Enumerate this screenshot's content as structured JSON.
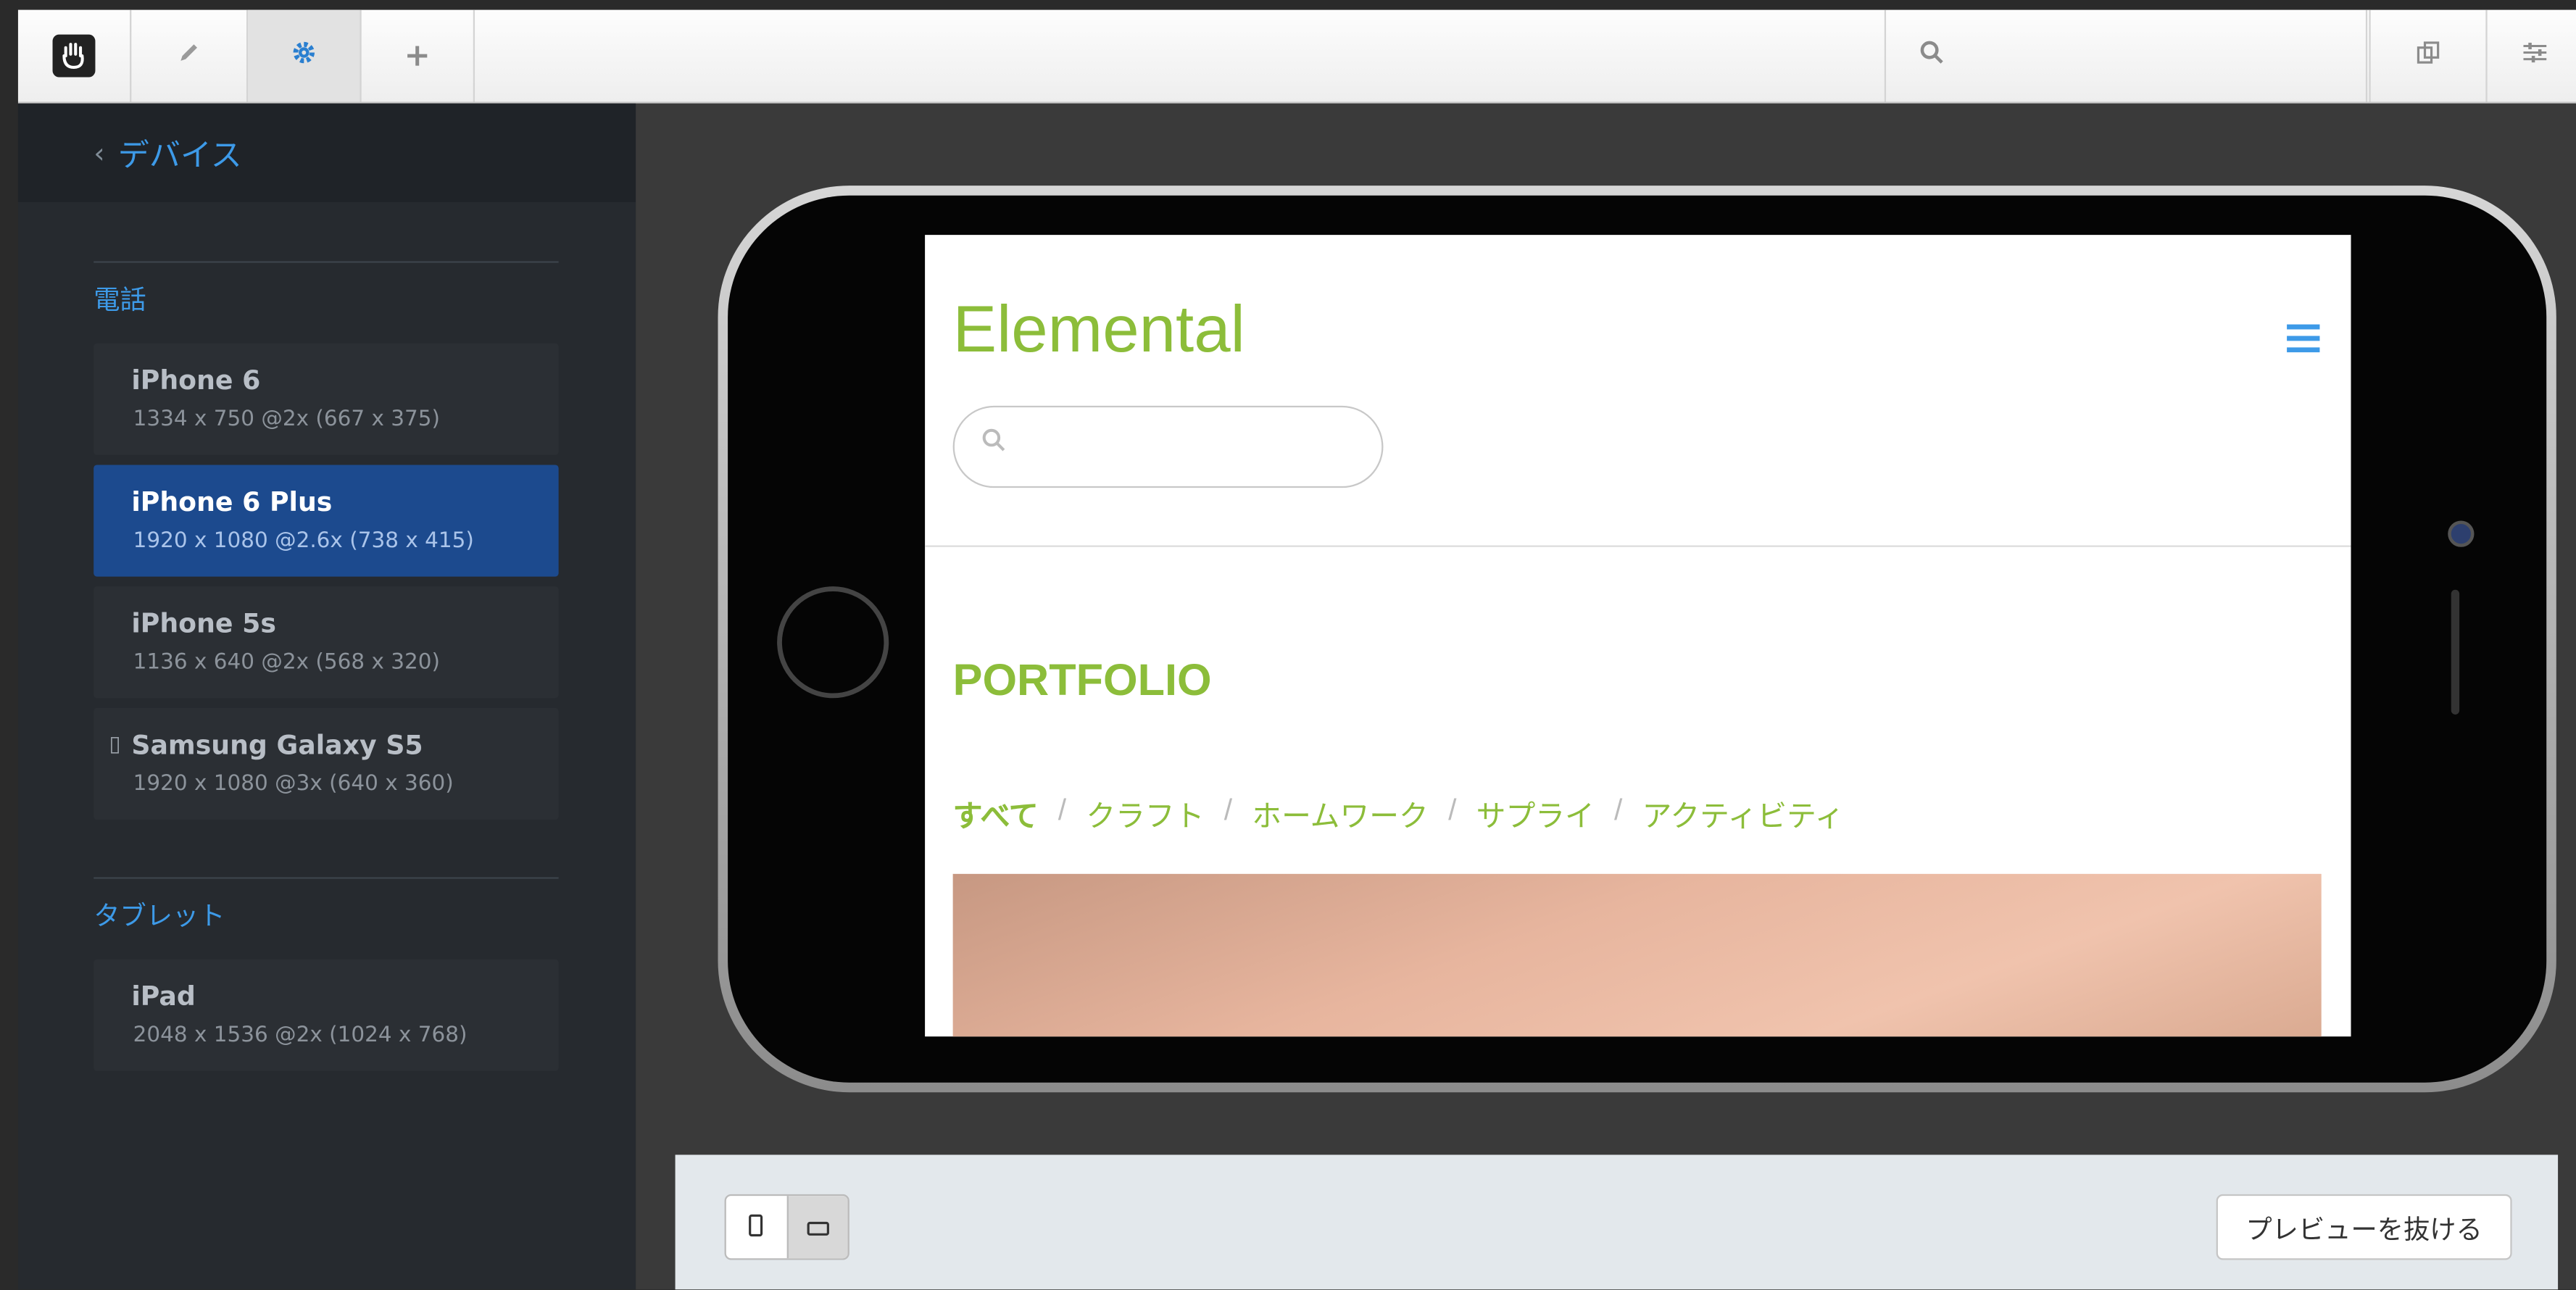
{
  "toolbar": {
    "icons": [
      "hand-logo-icon",
      "pencil-icon",
      "gear-icon",
      "plus-icon",
      "search-icon",
      "copy-icon",
      "sliders-icon"
    ],
    "search_value": ""
  },
  "sidebar": {
    "back_label": "デバイス",
    "sections": [
      {
        "title": "電話",
        "devices": [
          {
            "name": "iPhone 6",
            "resolution": "1334 x 750 @2x (667 x 375)",
            "os_icon": "apple-icon"
          },
          {
            "name": "iPhone 6 Plus",
            "resolution": "1920 x 1080 @2.6x (738 x 415)",
            "os_icon": "apple-icon",
            "selected": true
          },
          {
            "name": "iPhone 5s",
            "resolution": "1136 x 640 @2x (568 x 320)",
            "os_icon": "apple-icon"
          },
          {
            "name": "Samsung Galaxy S5",
            "resolution": "1920 x 1080 @3x (640 x 360)",
            "os_icon": "phone-icon"
          }
        ]
      },
      {
        "title": "タブレット",
        "devices": [
          {
            "name": "iPad",
            "resolution": "2048 x 1536 @2x (1024 x 768)",
            "os_icon": "apple-icon"
          }
        ]
      }
    ]
  },
  "preview": {
    "site_title": "Elemental",
    "search_placeholder": "",
    "section_heading": "PORTFOLIO",
    "filters": [
      "すべて",
      "クラフト",
      "ホームワーク",
      "サプライ",
      "アクティビティ"
    ],
    "active_filter": "すべて"
  },
  "bottombar": {
    "orientation": "landscape",
    "exit_label": "プレビューを抜ける"
  },
  "colors": {
    "accent_blue": "#3d9ae8",
    "brand_green": "#8cbd3a",
    "selected_bg": "#1c4a8e"
  }
}
